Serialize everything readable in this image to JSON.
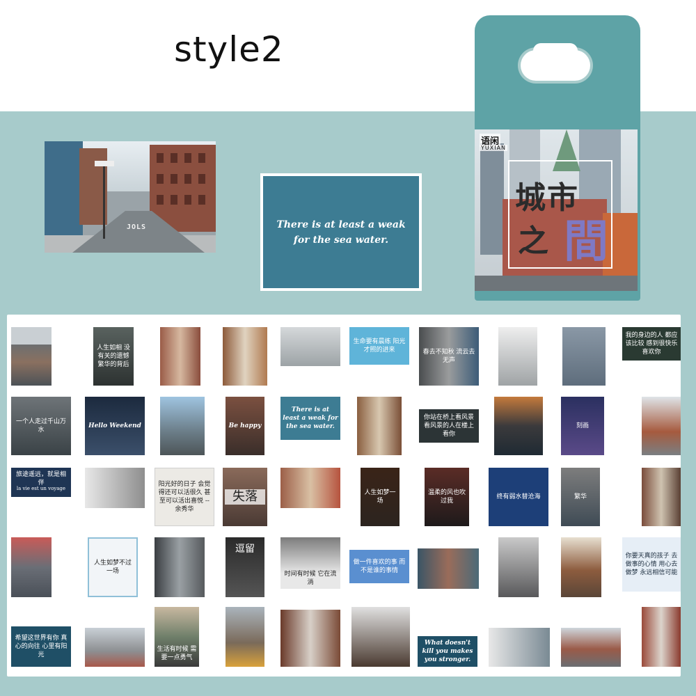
{
  "title": "style2",
  "featured": {
    "road_text": "JOLS",
    "quote_lines": [
      "There is at least a weak",
      "for the sea water."
    ]
  },
  "package": {
    "brand": "语闲",
    "brand_sub": "YUXIAN",
    "title_line1": "城市",
    "title_line2": "之",
    "title_line3": "間"
  },
  "stickers": {
    "r1c6": "生命要有晨练 阳光才照的进来",
    "r1c2": "人生如相 没有关的遗憾 繁华的背后",
    "r1c7": "春去不知秋 流云去无声",
    "r1c10": "我的身边的人 都应该比较 感到很快乐 喜欢你",
    "r2c1": "一个人走过千山万水",
    "r2c2": "Hello Weekend",
    "r2c4": "Be happy",
    "r2c5": "There is at least a weak for the sea water.",
    "r2c7": "你站在桥上看风景 看风景的人在楼上看你",
    "r2c9": "刻画",
    "r3c1": "旅途遥远，就是相伴",
    "r3c1_sub": "la vie est un voyage",
    "r3c3": "阳光好的日子 会觉得还可以活很久 甚至可以活出喜悦 --余秀华",
    "r3c4": "失落",
    "r3c6": "人生如梦一场",
    "r3c7": "温柔的风也吹过我",
    "r3c8": "终有弱水替沧海",
    "r3c9": "繁华",
    "r4c2": "人生如梦不过一场",
    "r4c4": "逗留",
    "r4c5": "时间有时候 它在流淌",
    "r4c6": "做一件喜欢的事 而不是谁的事情",
    "r4c10": "你要天真的孩子 去做事的心情 用心去做梦 永远相信可能",
    "r5c1": "希望这世界有你 真心的向往 心里有阳光",
    "r5c3": "生活有时候 需要一点勇气",
    "r5c7": "What doesn't kill you makes you stronger."
  }
}
